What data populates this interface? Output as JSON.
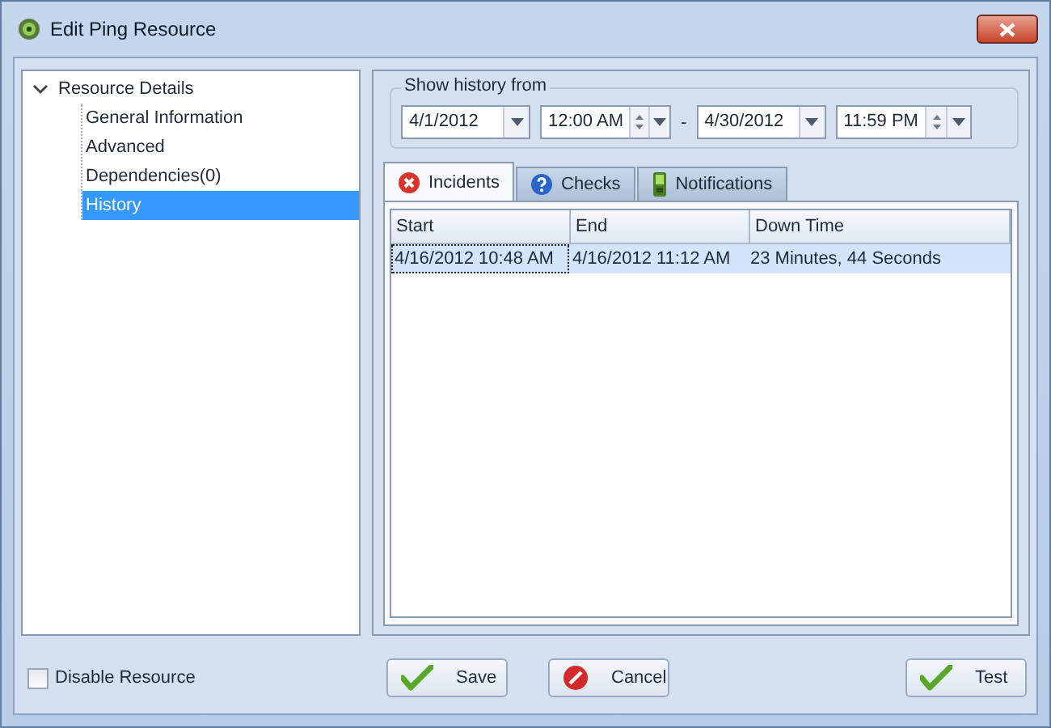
{
  "window": {
    "title": "Edit Ping Resource"
  },
  "tree": {
    "label": "Resource Details",
    "expanded": true,
    "children": [
      {
        "label": "General Information",
        "selected": false
      },
      {
        "label": "Advanced",
        "selected": false
      },
      {
        "label": "Dependencies(0)",
        "selected": false
      },
      {
        "label": "History",
        "selected": true
      }
    ]
  },
  "history_range": {
    "label": "Show history from",
    "from_date": "4/1/2012",
    "from_time": "12:00 AM",
    "separator": "-",
    "to_date": "4/30/2012",
    "to_time": "11:59 PM"
  },
  "tabs": [
    {
      "label": "Incidents",
      "selected": true,
      "kind": "error"
    },
    {
      "label": "Checks",
      "selected": false,
      "kind": "help"
    },
    {
      "label": "Notifications",
      "selected": false,
      "kind": "device"
    }
  ],
  "table": {
    "columns": [
      "Start",
      "End",
      "Down Time"
    ],
    "rows": [
      {
        "cells": [
          "4/16/2012 10:48 AM",
          "4/16/2012 11:12 AM",
          "23 Minutes, 44 Seconds"
        ],
        "selected": true
      }
    ]
  },
  "disable_resource": {
    "label": "Disable Resource",
    "checked": false
  },
  "buttons": [
    {
      "label": "Save",
      "kind": "ok"
    },
    {
      "label": "Cancel",
      "kind": "cancel"
    },
    {
      "label": "Test",
      "kind": "ok"
    }
  ]
}
